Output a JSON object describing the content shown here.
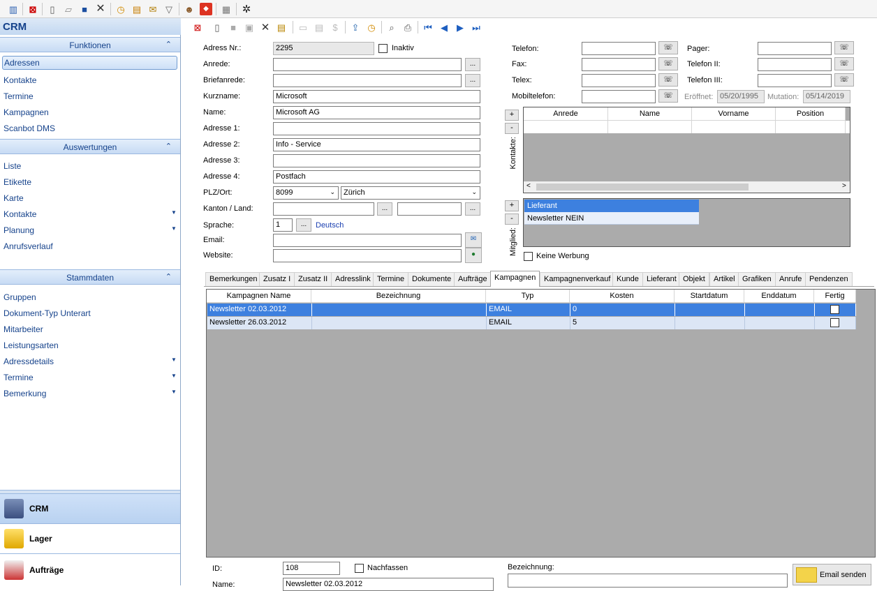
{
  "toolbar_top": {
    "icons": [
      "users-chart-icon",
      "close-red-icon",
      "new-doc-icon",
      "open-folder-icon",
      "save-icon",
      "delete-x-icon",
      "clock-icon",
      "chart-icon",
      "mail-icon",
      "filter-icon",
      "person-icon",
      "red-app-icon",
      "grid-icon",
      "gear-icon"
    ],
    "search_value": ""
  },
  "sidebar": {
    "title": "CRM",
    "sections": [
      {
        "title": "Funktionen",
        "items": [
          "Adressen",
          "Kontakte",
          "Termine",
          "Kampagnen",
          "Scanbot DMS"
        ]
      },
      {
        "title": "Auswertungen",
        "items": [
          "Liste",
          "Etikette",
          "Karte",
          "Kontakte",
          "Planung",
          "Anrufsverlauf"
        ]
      },
      {
        "title": "Stammdaten",
        "items": [
          "Gruppen",
          "Dokument-Typ Unterart",
          "Mitarbeiter",
          "Leistungsarten",
          "Adressdetails",
          "Termine",
          "Bemerkung"
        ]
      }
    ],
    "modules": [
      "CRM",
      "Lager",
      "Aufträge"
    ]
  },
  "form": {
    "labels": {
      "adress_nr": "Adress Nr.:",
      "inaktiv": "Inaktiv",
      "anrede": "Anrede:",
      "briefanrede": "Briefanrede:",
      "kurzname": "Kurzname:",
      "name": "Name:",
      "adresse1": "Adresse 1:",
      "adresse2": "Adresse 2:",
      "adresse3": "Adresse 3:",
      "adresse4": "Adresse 4:",
      "plz_ort": "PLZ/Ort:",
      "kanton_land": "Kanton / Land:",
      "sprache": "Sprache:",
      "email": "Email:",
      "website": "Website:",
      "telefon": "Telefon:",
      "fax": "Fax:",
      "telex": "Telex:",
      "mobiltelefon": "Mobiltelefon:",
      "pager": "Pager:",
      "telefon2": "Telefon II:",
      "telefon3": "Telefon III:",
      "eroeffnet": "Eröffnet:",
      "mutation": "Mutation:",
      "kontakte": "Kontakte:",
      "mitglied": "Mitglied:",
      "keine_werbung": "Keine Werbung"
    },
    "values": {
      "adress_nr": "2295",
      "anrede": "",
      "briefanrede": "",
      "kurzname": "Microsoft",
      "name": "Microsoft AG",
      "adresse1": "",
      "adresse2": "Info - Service",
      "adresse3": "",
      "adresse4": "Postfach",
      "plz": "8099",
      "ort": "Zürich",
      "kanton": "",
      "land": "",
      "sprache_nr": "1",
      "sprache": "Deutsch",
      "email": "",
      "website": "",
      "eroeffnet": "05/20/1995",
      "mutation": "05/14/2019"
    },
    "kontakte_columns": [
      "Anrede",
      "Name",
      "Vorname",
      "Position"
    ],
    "mitglied_items": [
      "Lieferant",
      "Newsletter NEIN"
    ]
  },
  "tabs": [
    "Bemerkungen",
    "Zusatz I",
    "Zusatz II",
    "Adresslink",
    "Termine",
    "Dokumente",
    "Aufträge",
    "Kampagnen",
    "Kampagnenverkauf",
    "Kunde",
    "Lieferant",
    "Objekt",
    "Artikel",
    "Grafiken",
    "Anrufe",
    "Pendenzen"
  ],
  "active_tab": "Kampagnen",
  "campaign_grid": {
    "columns": [
      "Kampagnen Name",
      "Bezeichnung",
      "Typ",
      "Kosten",
      "Startdatum",
      "Enddatum",
      "Fertig"
    ],
    "rows": [
      {
        "name": "Newsletter 02.03.2012",
        "bezeichnung": "",
        "typ": "EMAIL",
        "kosten": "0",
        "start": "",
        "end": "",
        "fertig": false
      },
      {
        "name": "Newsletter 26.03.2012",
        "bezeichnung": "",
        "typ": "EMAIL",
        "kosten": "5",
        "start": "",
        "end": "",
        "fertig": false
      }
    ]
  },
  "detail": {
    "id_label": "ID:",
    "id_value": "108",
    "nachfassen": "Nachfassen",
    "bezeichnung_label": "Bezeichnung:",
    "name_label": "Name:",
    "name_value": "Newsletter 02.03.2012",
    "email_button": "Email senden"
  },
  "colors": {
    "accent": "#15428b",
    "selection": "#3d80df",
    "grid_bg": "#ababab"
  }
}
